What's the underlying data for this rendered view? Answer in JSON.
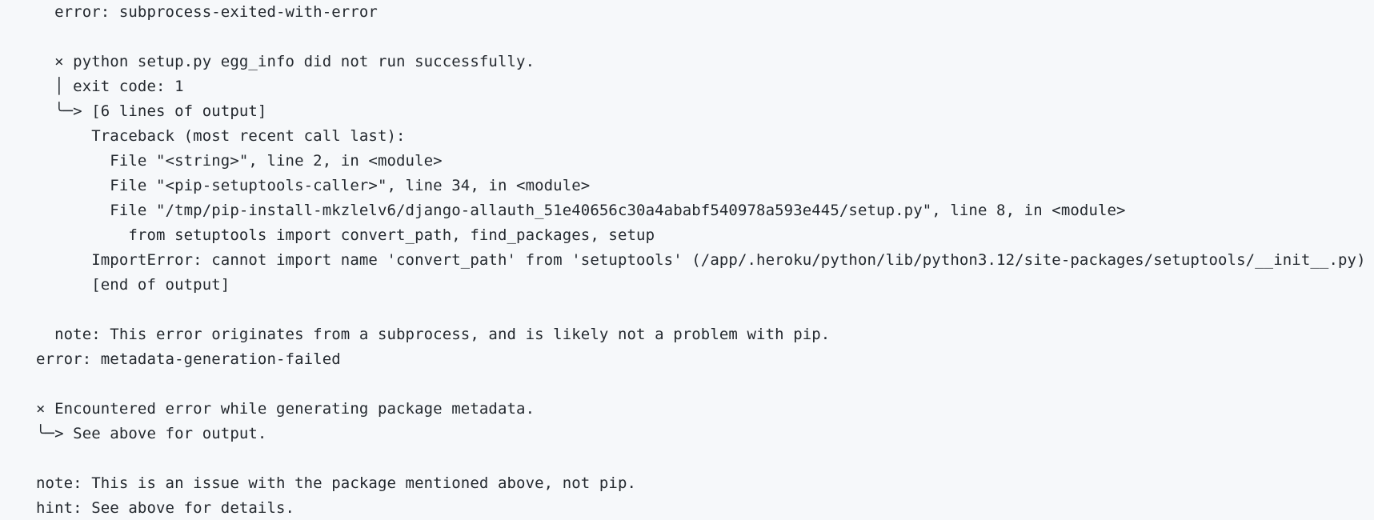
{
  "code_block": {
    "lines": [
      "  error: subprocess-exited-with-error",
      "",
      "  × python setup.py egg_info did not run successfully.",
      "  │ exit code: 1",
      "  ╰─> [6 lines of output]",
      "      Traceback (most recent call last):",
      "        File \"<string>\", line 2, in <module>",
      "        File \"<pip-setuptools-caller>\", line 34, in <module>",
      "        File \"/tmp/pip-install-mkzlelv6/django-allauth_51e40656c30a4ababf540978a593e445/setup.py\", line 8, in <module>",
      "          from setuptools import convert_path, find_packages, setup",
      "      ImportError: cannot import name 'convert_path' from 'setuptools' (/app/.heroku/python/lib/python3.12/site-packages/setuptools/__init__.py)",
      "      [end of output]",
      "",
      "  note: This error originates from a subprocess, and is likely not a problem with pip.",
      "error: metadata-generation-failed",
      "",
      "× Encountered error while generating package metadata.",
      "╰─> See above for output.",
      "",
      "note: This is an issue with the package mentioned above, not pip.",
      "hint: See above for details."
    ]
  }
}
